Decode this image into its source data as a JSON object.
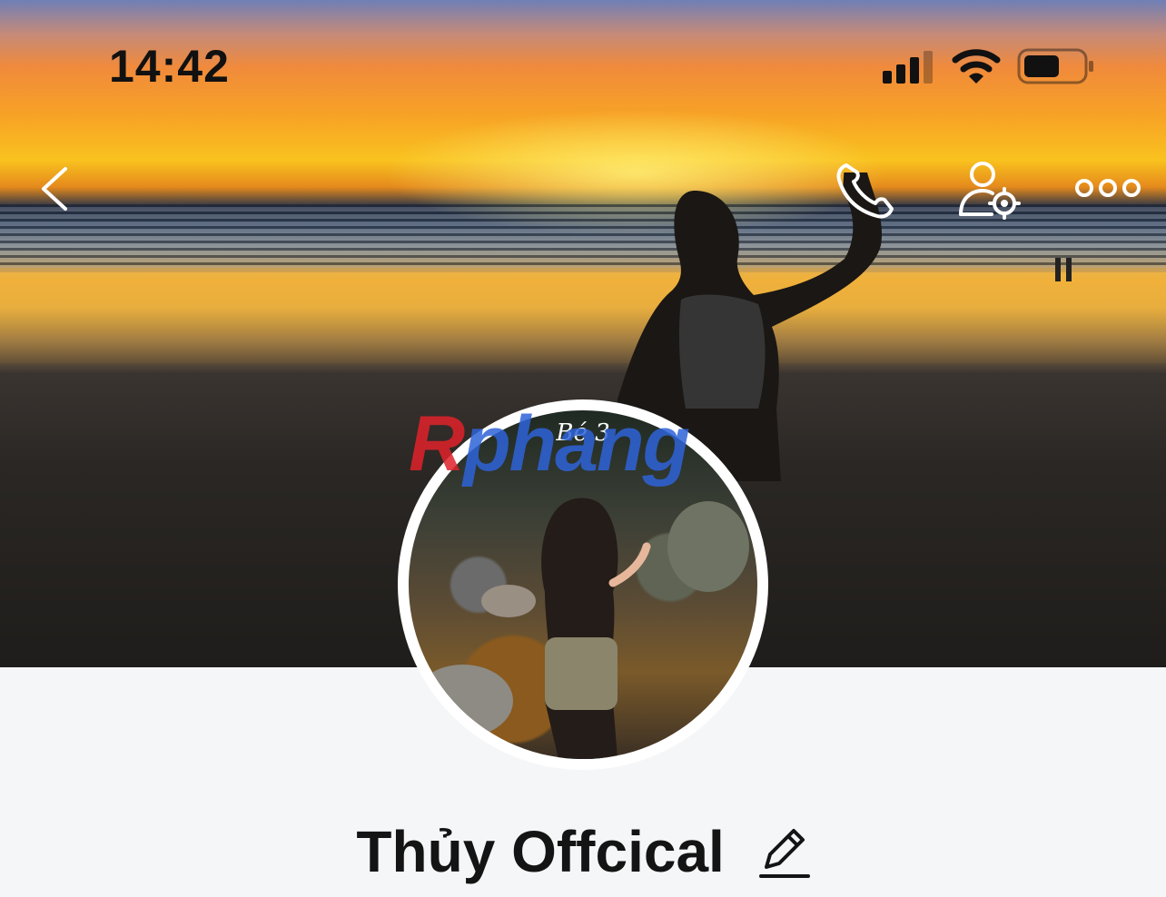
{
  "status_bar": {
    "time": "14:42",
    "icons": [
      "cellular-signal-icon",
      "wifi-icon",
      "battery-icon"
    ]
  },
  "header": {
    "icons": [
      "back-chevron-icon",
      "phone-icon",
      "user-settings-icon",
      "more-dots-icon"
    ]
  },
  "profile": {
    "avatar_caption": "Bé 3",
    "name": "Thủy Offcical",
    "edit_icon": "pencil-icon"
  },
  "watermark": {
    "first": "R",
    "rest": "phang"
  },
  "colors": {
    "page_background": "#f5f6f8",
    "text_primary": "#141414",
    "icon_white": "#ffffff",
    "watermark_red": "#e0222a",
    "watermark_blue": "#2e63d8"
  }
}
